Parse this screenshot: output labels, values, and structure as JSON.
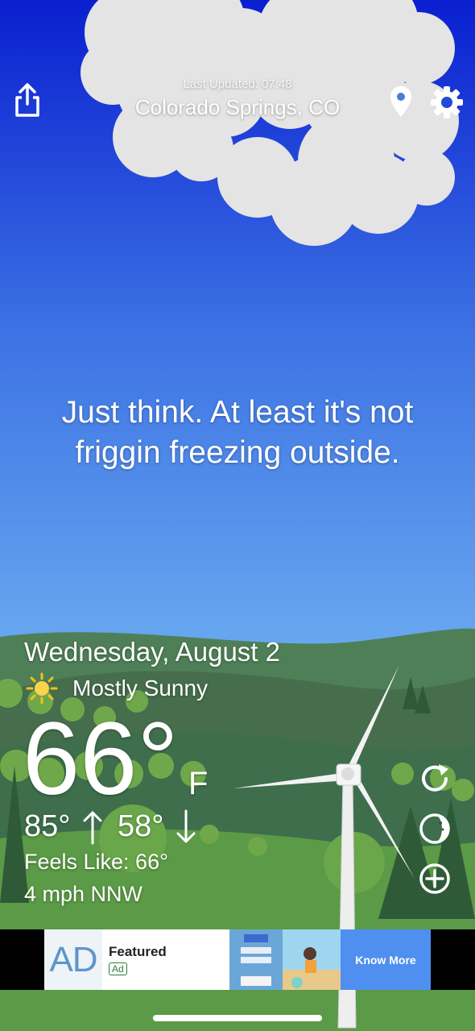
{
  "header": {
    "last_updated": "Last Updated: 07:48",
    "location": "Colorado Springs, CO",
    "share_icon": "share-icon",
    "location_icon": "location-pin-icon",
    "settings_icon": "gear-icon"
  },
  "message": {
    "line1": "Just think. At least it's not",
    "line2": "friggin freezing outside."
  },
  "weather": {
    "date": "Wednesday, August 2",
    "condition": "Mostly Sunny",
    "condition_icon": "sun-icon",
    "temperature": "66°",
    "unit": "F",
    "high": "85°",
    "low": "58°",
    "feels_like": "Feels Like: 66°",
    "wind": "4 mph NNW"
  },
  "side_actions": [
    {
      "icon": "refresh-icon"
    },
    {
      "icon": "theme-icon"
    },
    {
      "icon": "add-icon"
    }
  ],
  "ad": {
    "logo": "AD",
    "title": "Featured",
    "badge": "Ad",
    "cta": "Know More"
  },
  "colors": {
    "sky_top": "#0a1fd0",
    "sky_bottom": "#6aaaf0",
    "hill_light": "#5b9a46",
    "hill_dark": "#3e6e4c",
    "ad_cta": "#4f8ff0"
  }
}
